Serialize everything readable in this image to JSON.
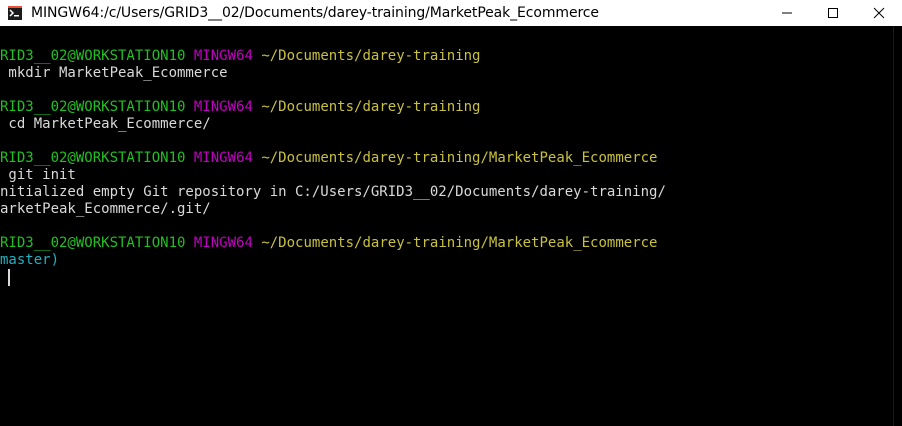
{
  "window": {
    "title": "MINGW64:/c/Users/GRID3__02/Documents/darey-training/MarketPeak_Ecommerce",
    "icon": "git-bash-icon"
  },
  "colors": {
    "user_host": "#20c020",
    "system": "#c000c0",
    "path": "#c8c040",
    "branch": "#20b0c0",
    "text": "#d9d9d9"
  },
  "terminal": {
    "prompts": [
      {
        "user_host": "RID3__02@WORKSTATION10",
        "system": "MINGW64",
        "path": "~/Documents/darey-training",
        "command": " mkdir MarketPeak_Ecommerce"
      },
      {
        "user_host": "RID3__02@WORKSTATION10",
        "system": "MINGW64",
        "path": "~/Documents/darey-training",
        "command": " cd MarketPeak_Ecommerce/"
      },
      {
        "user_host": "RID3__02@WORKSTATION10",
        "system": "MINGW64",
        "path": "~/Documents/darey-training/MarketPeak_Ecommerce",
        "command": " git init",
        "output": [
          "nitialized empty Git repository in C:/Users/GRID3__02/Documents/darey-training/",
          "arketPeak_Ecommerce/.git/"
        ]
      },
      {
        "user_host": "RID3__02@WORKSTATION10",
        "system": "MINGW64",
        "path": "~/Documents/darey-training/MarketPeak_Ecommerce",
        "branch": "master)"
      }
    ]
  }
}
